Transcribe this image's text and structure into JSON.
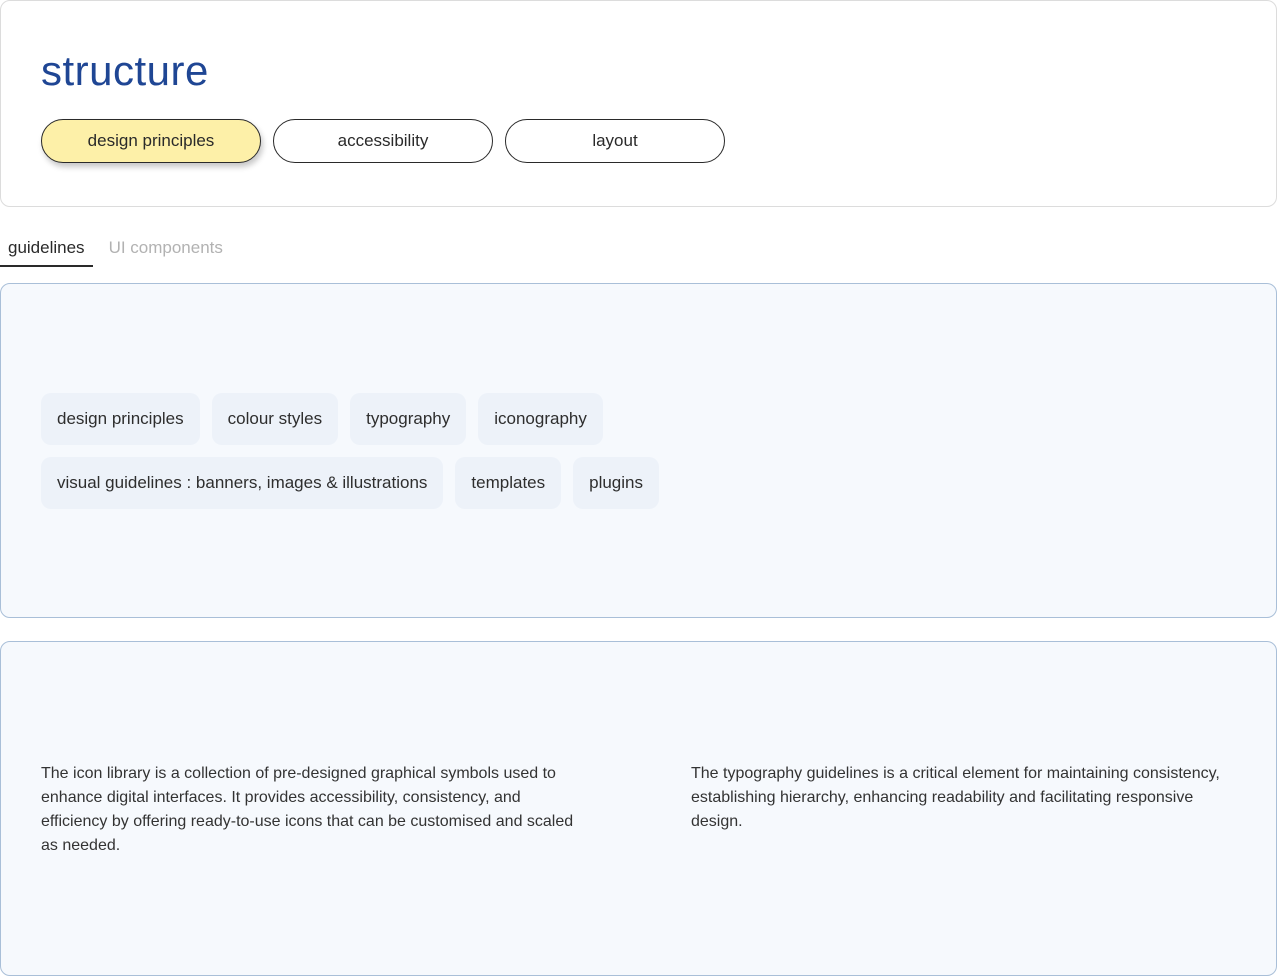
{
  "header": {
    "title": "structure",
    "pills": [
      {
        "label": "design principles",
        "active": true
      },
      {
        "label": "accessibility",
        "active": false
      },
      {
        "label": "layout",
        "active": false
      }
    ]
  },
  "tabs": [
    {
      "label": "guidelines",
      "active": true
    },
    {
      "label": "UI components",
      "active": false
    }
  ],
  "chips": {
    "row1": [
      "design principles",
      "colour styles",
      "typography",
      "iconography"
    ],
    "row2": [
      "visual guidelines : banners, images & illustrations",
      "templates",
      "plugins"
    ]
  },
  "descriptions": {
    "icon_library": "The icon library is a collection of pre-designed graphical symbols used to enhance digital interfaces. It provides accessibility, consistency, and efficiency by offering ready-to-use icons that can be customised and scaled as needed.",
    "typography": "The typography guidelines is a critical element for maintaining consistency, establishing hierarchy, enhancing readability and facilitating responsive design."
  },
  "colors": {
    "title": "#1f4694",
    "active_pill": "#fdf0a8",
    "panel_bg": "#f6f9fd",
    "panel_border": "#a9bfd8",
    "chip_bg": "#edf2f9"
  }
}
